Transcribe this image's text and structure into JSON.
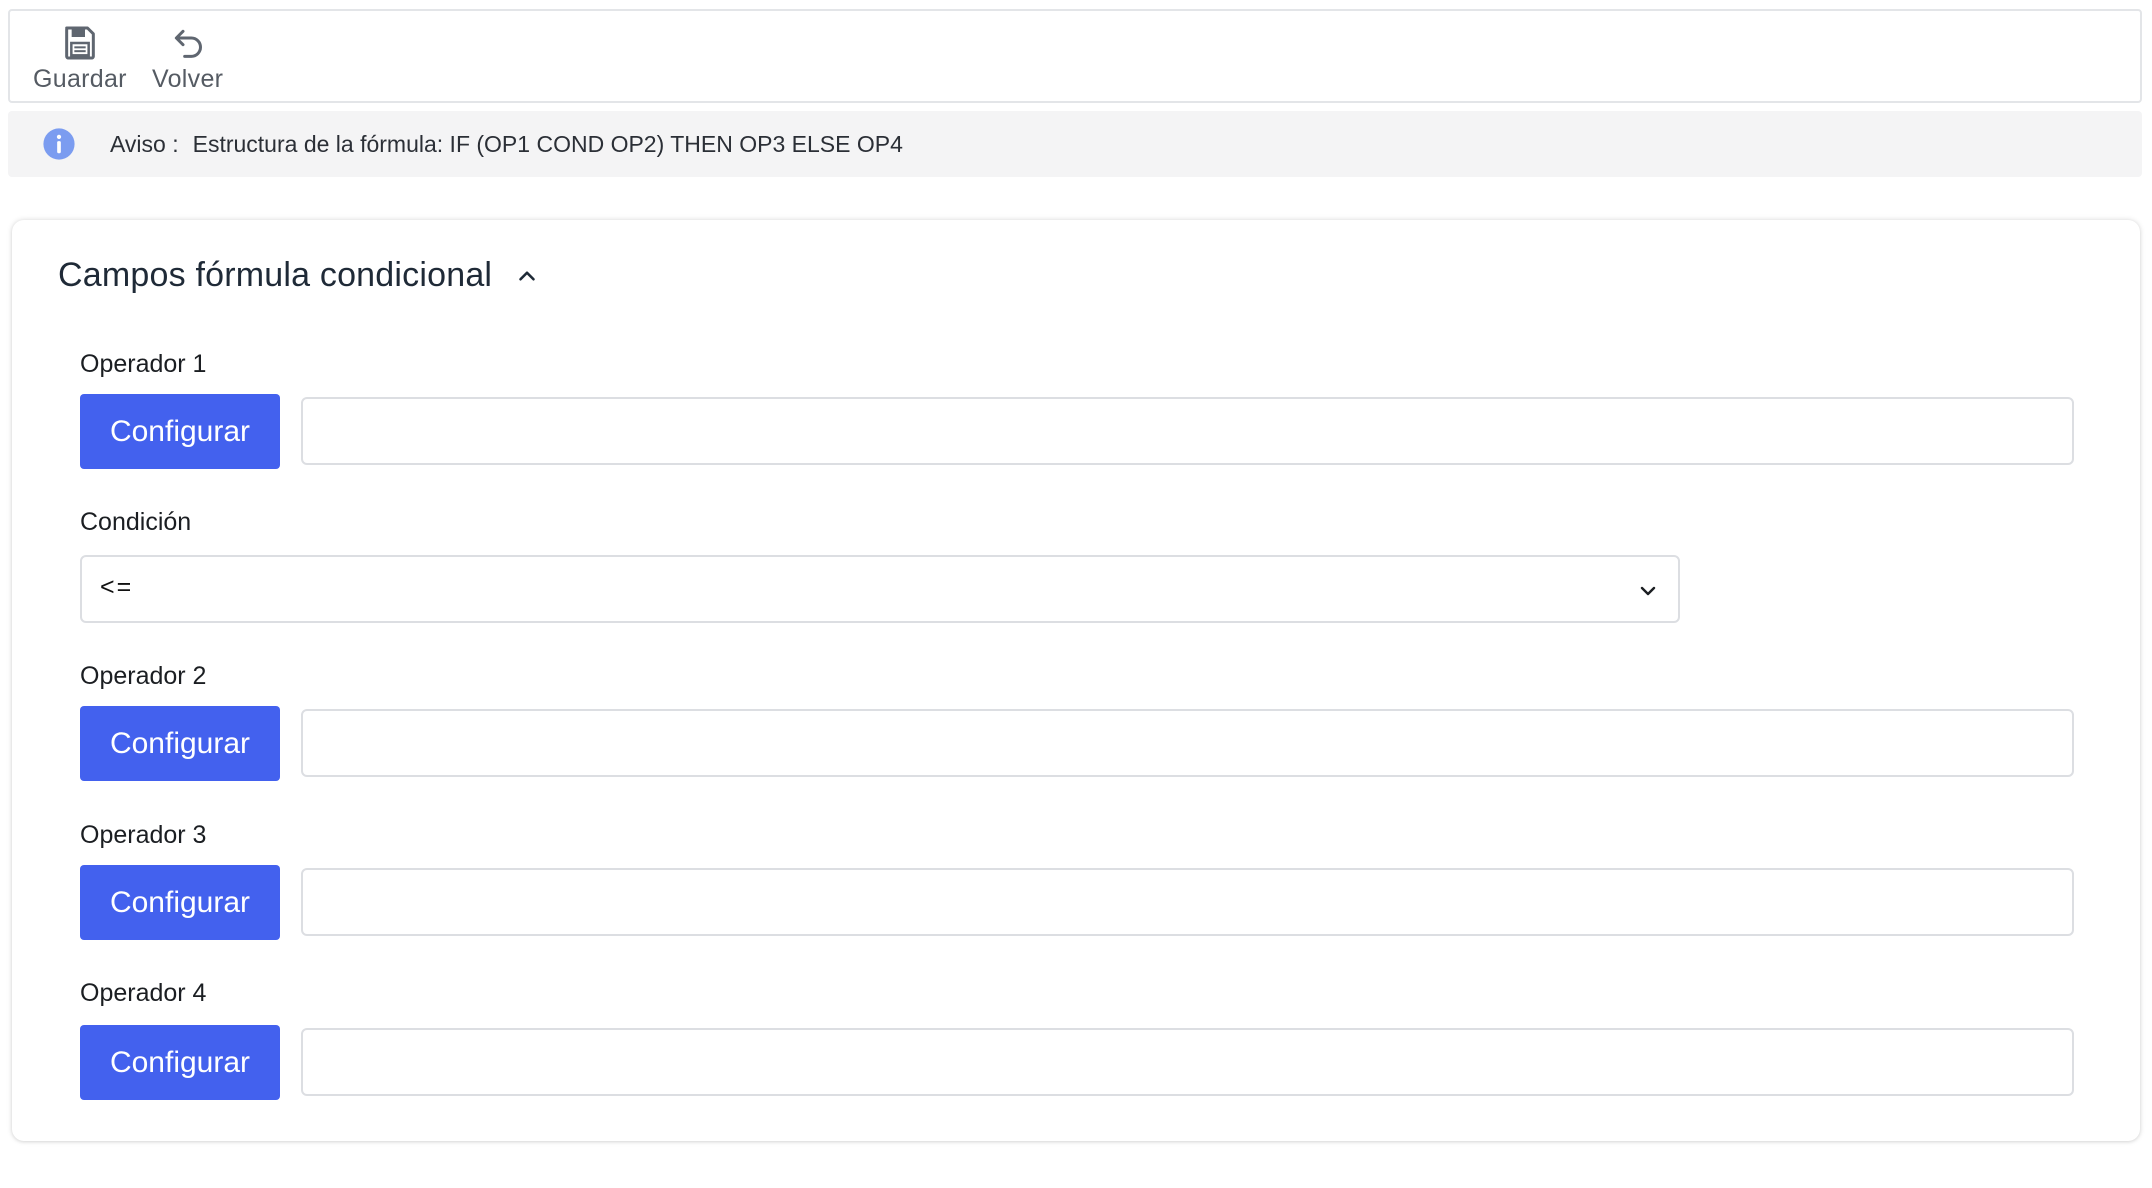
{
  "toolbar": {
    "save_label": "Guardar",
    "save_icon": "save-icon",
    "back_label": "Volver",
    "back_icon": "undo-icon"
  },
  "notice": {
    "icon": "info-icon",
    "title": "Aviso :",
    "message": "Estructura de la fórmula: IF (OP1 COND OP2) THEN OP3 ELSE OP4"
  },
  "card": {
    "title": "Campos fórmula condicional",
    "collapse_icon": "chevron-up-icon"
  },
  "fields": {
    "op1": {
      "label": "Operador 1",
      "button": "Configurar",
      "value": ""
    },
    "condition": {
      "label": "Condición",
      "selected": "<=",
      "icon": "chevron-down-icon"
    },
    "op2": {
      "label": "Operador 2",
      "button": "Configurar",
      "value": ""
    },
    "op3": {
      "label": "Operador 3",
      "button": "Configurar",
      "value": ""
    },
    "op4": {
      "label": "Operador 4",
      "button": "Configurar",
      "value": ""
    }
  },
  "colors": {
    "primary_button": "#4361ee",
    "info_icon": "#7b9cf0",
    "notice_background": "#f4f4f5"
  }
}
